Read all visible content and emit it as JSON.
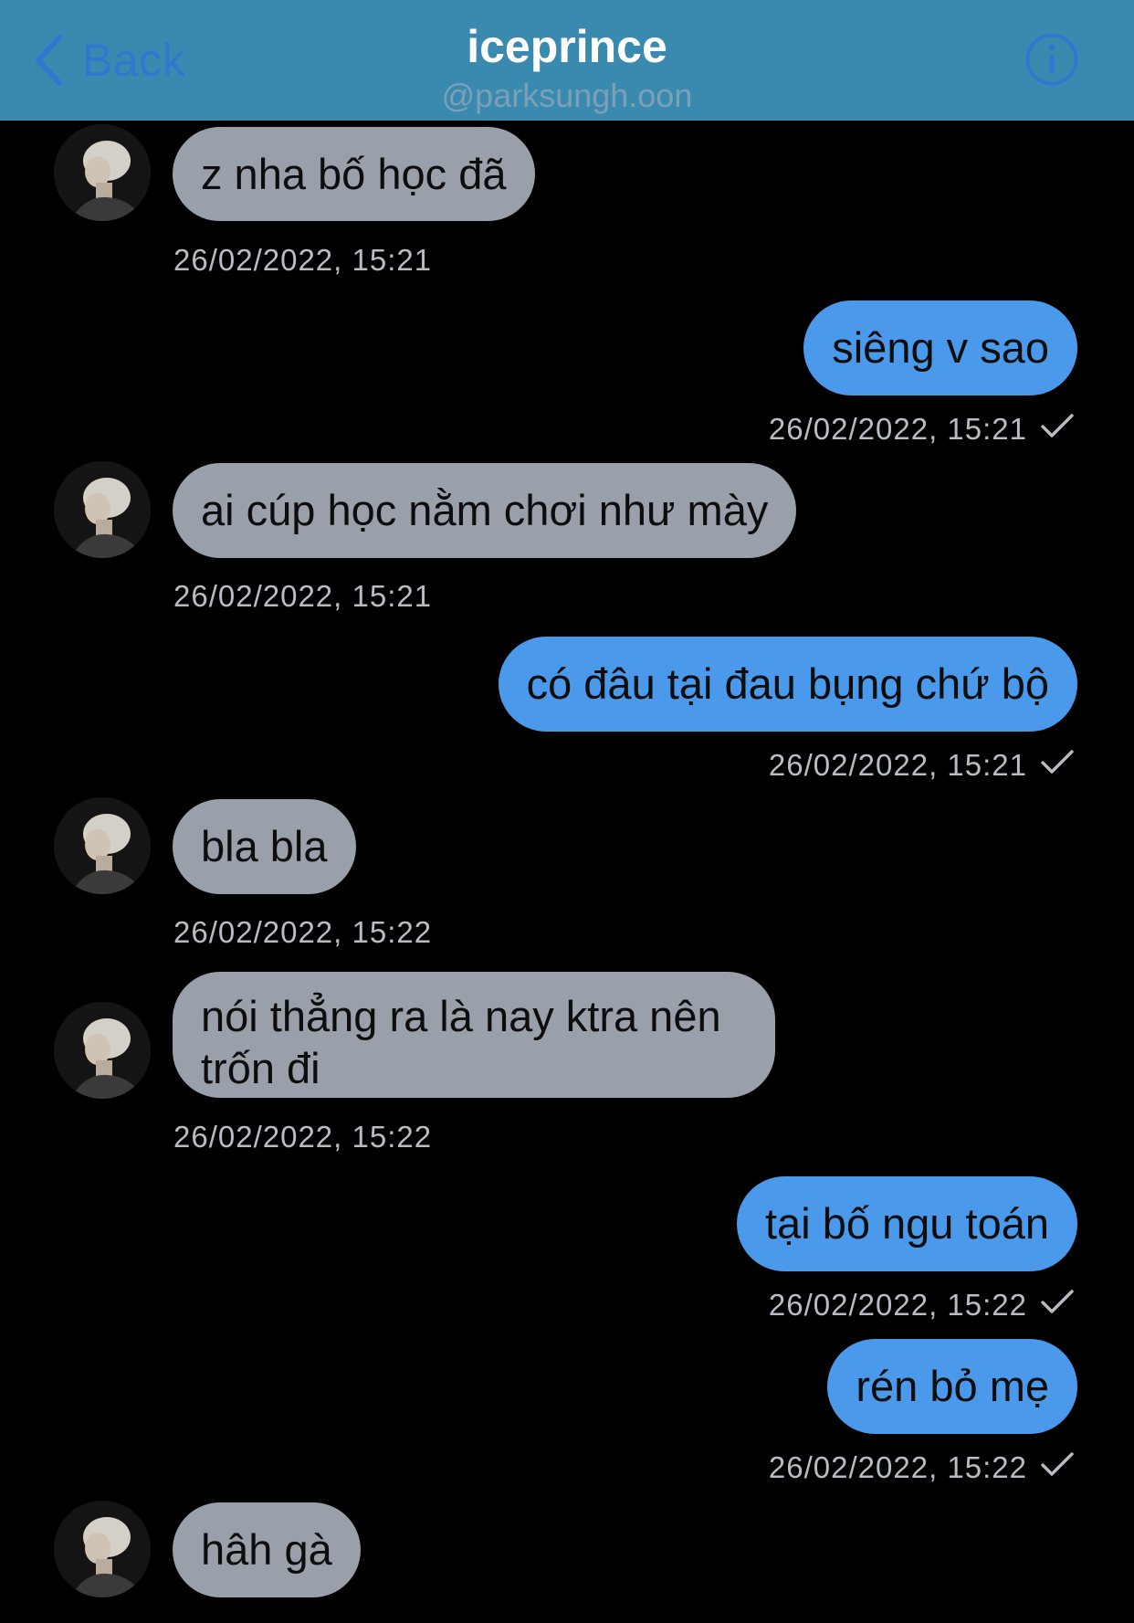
{
  "header": {
    "back_label": "Back",
    "title": "iceprince",
    "subtitle": "@parksungh.oon"
  },
  "colors": {
    "header_bg": "#3a89af",
    "accent": "#2f78cf",
    "incoming_bubble": "#9aa0aa",
    "outgoing_bubble": "#4b99ea",
    "background": "#000000"
  },
  "messages": [
    {
      "direction": "in",
      "text": "z nha bố học đã",
      "time": "26/02/2022, 15:21"
    },
    {
      "direction": "out",
      "text": "siêng v sao",
      "time": "26/02/2022, 15:21",
      "status": "sent"
    },
    {
      "direction": "in",
      "text": "ai cúp học nằm chơi như mày",
      "time": "26/02/2022, 15:21"
    },
    {
      "direction": "out",
      "text": "có đâu tại đau bụng chứ bộ",
      "time": "26/02/2022, 15:21",
      "status": "sent"
    },
    {
      "direction": "in",
      "text": "bla bla",
      "time": "26/02/2022, 15:22"
    },
    {
      "direction": "in",
      "text": "nói thẳng ra là nay ktra nên trốn đi",
      "time": "26/02/2022, 15:22"
    },
    {
      "direction": "out",
      "text": "tại bố ngu toán",
      "time": "26/02/2022, 15:22",
      "status": "sent"
    },
    {
      "direction": "out",
      "text": "rén bỏ mẹ",
      "time": "26/02/2022, 15:22",
      "status": "sent"
    },
    {
      "direction": "in",
      "text": "hâh gà",
      "time": ""
    }
  ]
}
